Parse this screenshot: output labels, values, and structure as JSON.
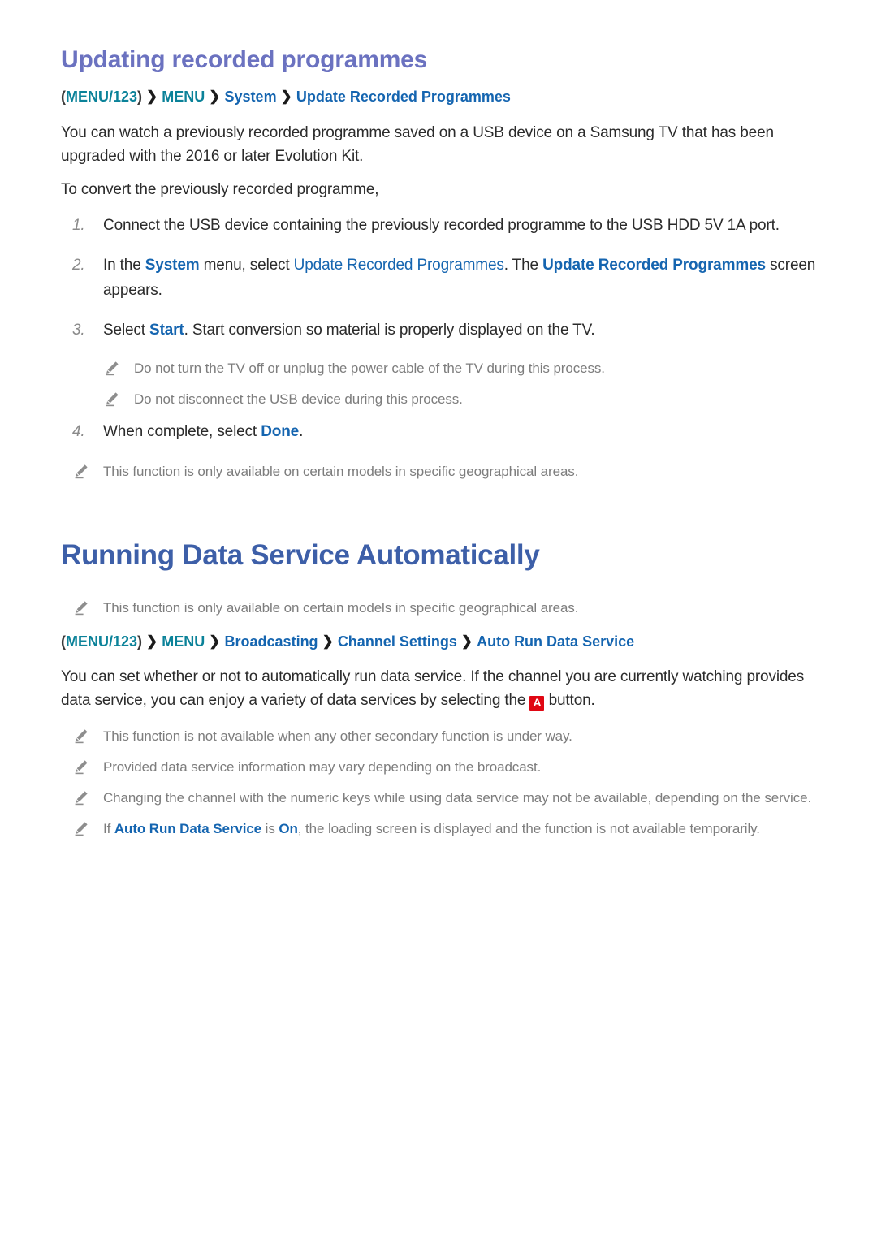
{
  "section1": {
    "title": "Updating recorded programmes",
    "breadcrumb": {
      "open_paren": "(",
      "item1": "MENU/123",
      "close_paren": ")",
      "chevron": "❯",
      "item2": "MENU",
      "item3": "System",
      "item4": "Update Recorded Programmes"
    },
    "intro": "You can watch a previously recorded programme saved on a USB device on a Samsung TV that has been upgraded with the 2016 or later Evolution Kit.",
    "lead_in": "To convert the previously recorded programme,",
    "steps": [
      {
        "num": "1.",
        "parts": [
          {
            "t": "Connect the USB device containing the previously recorded programme to the USB HDD 5V 1A port.",
            "style": "plain"
          }
        ]
      },
      {
        "num": "2.",
        "parts": [
          {
            "t": "In the ",
            "style": "plain"
          },
          {
            "t": "System",
            "style": "link-bold"
          },
          {
            "t": " menu, select ",
            "style": "plain"
          },
          {
            "t": "Update Recorded Programmes",
            "style": "link"
          },
          {
            "t": ". The ",
            "style": "plain"
          },
          {
            "t": "Update Recorded Programmes",
            "style": "link-bold"
          },
          {
            "t": " screen appears.",
            "style": "plain"
          }
        ]
      },
      {
        "num": "3.",
        "parts": [
          {
            "t": "Select ",
            "style": "plain"
          },
          {
            "t": "Start",
            "style": "link-bold"
          },
          {
            "t": ". Start conversion so material is properly displayed on the TV.",
            "style": "plain"
          }
        ]
      },
      {
        "num": "4.",
        "parts": [
          {
            "t": "When complete, select ",
            "style": "plain"
          },
          {
            "t": "Done",
            "style": "link-bold"
          },
          {
            "t": ".",
            "style": "plain"
          }
        ]
      }
    ],
    "substep_notes": [
      "Do not turn the TV off or unplug the power cable of the TV during this process.",
      "Do not disconnect the USB device during this process."
    ],
    "trailing_note": "This function is only available on certain models in specific geographical areas."
  },
  "section2": {
    "title": "Running Data Service Automatically",
    "leading_note": "This function is only available on certain models in specific geographical areas.",
    "breadcrumb": {
      "open_paren": "(",
      "item1": "MENU/123",
      "close_paren": ")",
      "chevron": "❯",
      "item2": "MENU",
      "item3": "Broadcasting",
      "item4": "Channel Settings",
      "item5": "Auto Run Data Service"
    },
    "body_pre": "You can set whether or not to automatically run data service. If the channel you are currently watching provides data service, you can enjoy a variety of data services by selecting the ",
    "key_label": "A",
    "body_post": " button.",
    "notes": [
      {
        "parts": [
          {
            "t": "This function is not available when any other secondary function is under way.",
            "style": "plain"
          }
        ]
      },
      {
        "parts": [
          {
            "t": "Provided data service information may vary depending on the broadcast.",
            "style": "plain"
          }
        ]
      },
      {
        "parts": [
          {
            "t": "Changing the channel with the numeric keys while using data service may not be available, depending on the service.",
            "style": "plain"
          }
        ]
      },
      {
        "parts": [
          {
            "t": "If ",
            "style": "plain"
          },
          {
            "t": "Auto Run Data Service",
            "style": "link-bold"
          },
          {
            "t": " is ",
            "style": "plain"
          },
          {
            "t": "On",
            "style": "link-bold"
          },
          {
            "t": ", the loading screen is displayed and the function is not available temporarily.",
            "style": "plain"
          }
        ]
      }
    ]
  },
  "colors": {
    "heading_purple": "#6b72c0",
    "heading_blue": "#3d5fa8",
    "breadcrumb_teal": "#0b8299",
    "link_blue": "#1565b0",
    "note_gray": "#7d7d7d",
    "key_red": "#e00713"
  }
}
